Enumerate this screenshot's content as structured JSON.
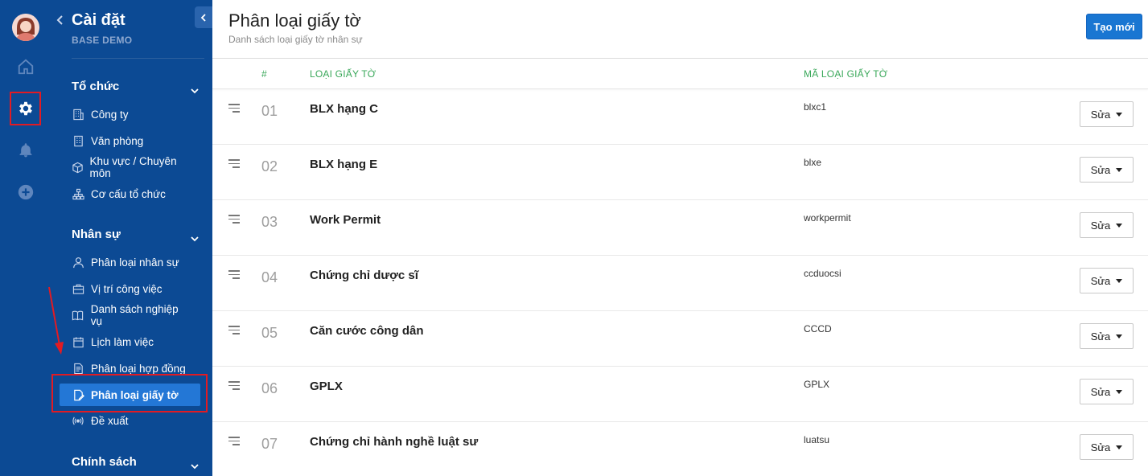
{
  "colors": {
    "sidebar": "#0c4a94",
    "active_item": "#2377d6",
    "accent_button": "#1976d2",
    "header_green": "#3aa85a",
    "highlight_red": "#e21b23"
  },
  "rail": {
    "icons": [
      "avatar",
      "home-icon",
      "gear-icon",
      "bell-icon",
      "plus-circle-icon"
    ]
  },
  "sidebar": {
    "title": "Cài đặt",
    "subtitle": "BASE DEMO",
    "groups": [
      {
        "label": "Tổ chức",
        "items": [
          {
            "label": "Công ty",
            "icon": "building-icon"
          },
          {
            "label": "Văn phòng",
            "icon": "office-icon"
          },
          {
            "label": "Khu vực / Chuyên môn",
            "icon": "cube-icon"
          },
          {
            "label": "Cơ cấu tổ chức",
            "icon": "org-chart-icon"
          }
        ]
      },
      {
        "label": "Nhân sự",
        "items": [
          {
            "label": "Phân loại nhân sự",
            "icon": "user-icon"
          },
          {
            "label": "Vị trí công việc",
            "icon": "briefcase-icon"
          },
          {
            "label": "Danh sách nghiệp vụ",
            "icon": "book-icon"
          },
          {
            "label": "Lịch làm việc",
            "icon": "calendar-icon"
          },
          {
            "label": "Phân loại hợp đồng",
            "icon": "contract-icon"
          },
          {
            "label": "Phân loại giấy tờ",
            "icon": "document-edit-icon",
            "active": true
          },
          {
            "label": "Đề xuất",
            "icon": "broadcast-icon"
          }
        ]
      },
      {
        "label": "Chính sách",
        "items": []
      }
    ]
  },
  "main": {
    "title": "Phân loại giấy tờ",
    "subtitle": "Danh sách loại giấy tờ nhân sự",
    "create_label": "Tạo mới",
    "columns": {
      "index": "#",
      "name": "LOẠI GIẤY TỜ",
      "code": "MÃ LOẠI GIẤY TỜ"
    },
    "edit_label": "Sửa",
    "rows": [
      {
        "num": "01",
        "name": "BLX hạng C",
        "code": "blxc1"
      },
      {
        "num": "02",
        "name": "BLX hạng E",
        "code": "blxe"
      },
      {
        "num": "03",
        "name": "Work Permit",
        "code": "workpermit"
      },
      {
        "num": "04",
        "name": "Chứng chỉ dược sĩ",
        "code": "ccduocsi"
      },
      {
        "num": "05",
        "name": "Căn cước công dân",
        "code": "CCCD"
      },
      {
        "num": "06",
        "name": "GPLX",
        "code": "GPLX"
      },
      {
        "num": "07",
        "name": "Chứng chỉ hành nghề luật sư",
        "code": "luatsu"
      }
    ]
  }
}
